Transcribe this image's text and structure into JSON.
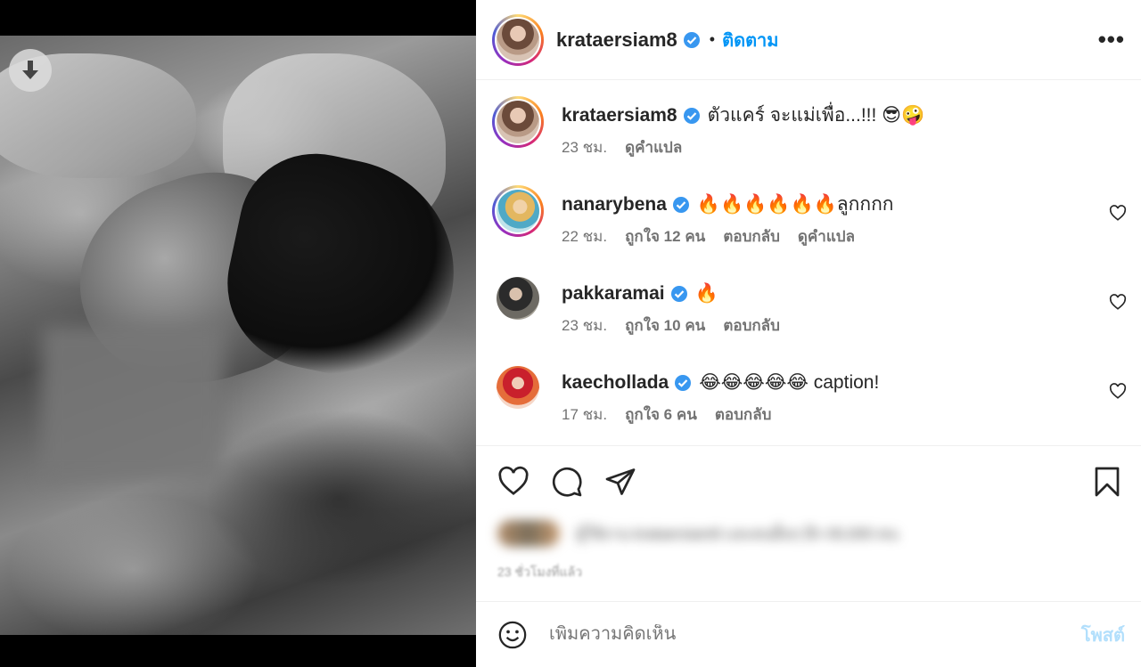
{
  "post": {
    "username": "krataersiam8",
    "follow_label": "ติดตาม",
    "separator": "•",
    "more_label": "•••"
  },
  "comments": [
    {
      "username": "krataersiam8",
      "text": "ตัวแคร์ จะแม่เพื่อ...!!! 😎🤪",
      "time": "23 ชม.",
      "likes": "",
      "reply": "",
      "translate": "ดูคำแปล",
      "verified": true,
      "has_heart": false
    },
    {
      "username": "nanarybena",
      "text": "🔥🔥🔥🔥🔥🔥ลูกกกก",
      "time": "22 ชม.",
      "likes": "ถูกใจ 12 คน",
      "reply": "ตอบกลับ",
      "translate": "ดูคำแปล",
      "verified": true,
      "has_heart": true
    },
    {
      "username": "pakkaramai",
      "text": "🔥",
      "time": "23 ชม.",
      "likes": "ถูกใจ 10 คน",
      "reply": "ตอบกลับ",
      "translate": "",
      "verified": true,
      "has_heart": true
    },
    {
      "username": "kaechollada",
      "text": "😂😂😂😂😂 caption!",
      "time": "17 ชม.",
      "likes": "ถูกใจ 6 คน",
      "reply": "ตอบกลับ",
      "translate": "",
      "verified": true,
      "has_heart": true
    }
  ],
  "likes_summary": "ผู้ใช้งาน krataersiam8 และคนอื่นๆ อีก 00,000 คน",
  "post_time": "23 ชั่วโมงที่แล้ว",
  "add_comment": {
    "placeholder": "เพิ่มความคิดเห็น",
    "post_label": "โพสต์"
  },
  "colors": {
    "accent": "#0095f6",
    "post_disabled": "#b2dffc",
    "verified": "#3897f0",
    "muted": "#737373"
  },
  "icons": [
    "download-icon",
    "verified-icon",
    "more-icon",
    "heart-icon",
    "comment-icon",
    "share-icon",
    "bookmark-icon",
    "emoji-icon"
  ]
}
